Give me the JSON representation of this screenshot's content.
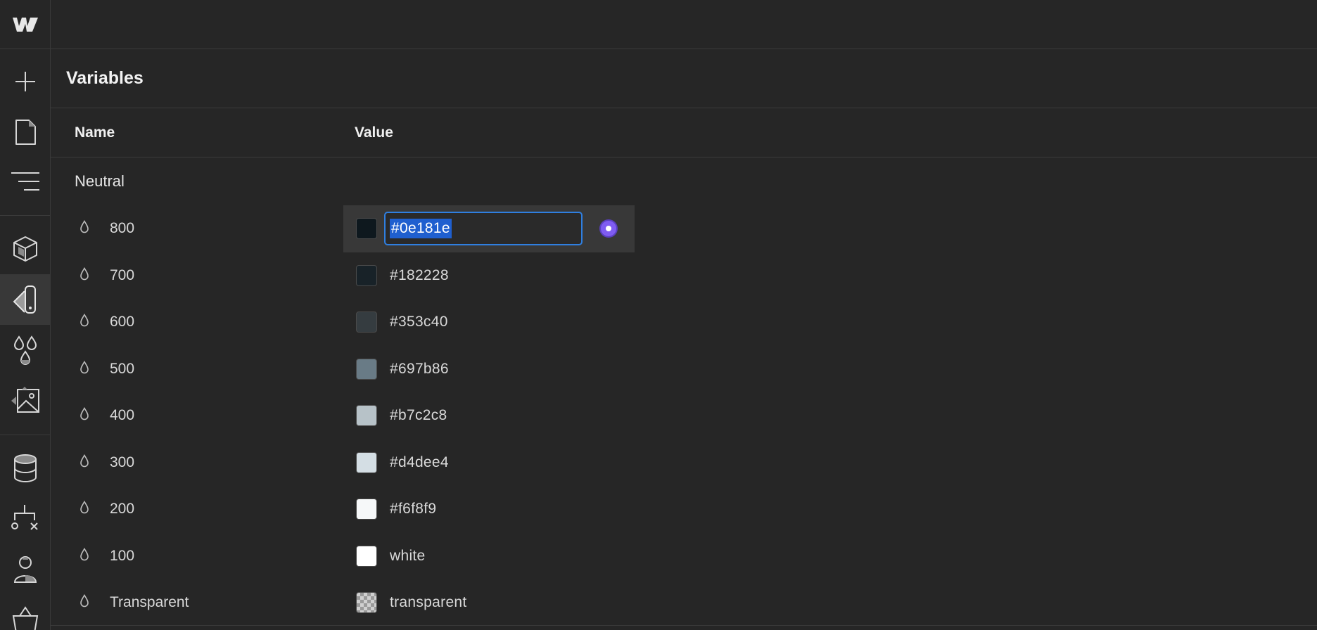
{
  "sidebar": {
    "tools": [
      {
        "name": "add-icon"
      },
      {
        "name": "page-icon"
      },
      {
        "name": "navigator-icon"
      },
      {
        "name": "components-icon"
      },
      {
        "name": "style-manager-icon"
      },
      {
        "name": "variables-icon"
      },
      {
        "name": "assets-icon"
      },
      {
        "name": "cms-icon"
      },
      {
        "name": "logic-icon"
      },
      {
        "name": "users-icon"
      },
      {
        "name": "ecommerce-icon"
      }
    ],
    "active_tool": "style-manager-icon"
  },
  "panel": {
    "title": "Variables",
    "columns": {
      "name": "Name",
      "value": "Value"
    },
    "group": "Neutral",
    "variables": [
      {
        "name": "800",
        "value": "#0e181e",
        "swatch": "#0e181e",
        "editing": true
      },
      {
        "name": "700",
        "value": "#182228",
        "swatch": "#182228"
      },
      {
        "name": "600",
        "value": "#353c40",
        "swatch": "#353c40"
      },
      {
        "name": "500",
        "value": "#697b86",
        "swatch": "#697b86"
      },
      {
        "name": "400",
        "value": "#b7c2c8",
        "swatch": "#b7c2c8"
      },
      {
        "name": "300",
        "value": "#d4dee4",
        "swatch": "#d4dee4"
      },
      {
        "name": "200",
        "value": "#f6f8f9",
        "swatch": "#f6f8f9"
      },
      {
        "name": "100",
        "value": "white",
        "swatch": "#ffffff"
      },
      {
        "name": "Transparent",
        "value": "transparent",
        "swatch": "transparent"
      }
    ]
  },
  "colors": {
    "background": "#262626",
    "border": "#3a3a3a",
    "selection": "#1f5fcf",
    "focus": "#2f7fe0",
    "bind_accent": "#7f5cf2"
  }
}
